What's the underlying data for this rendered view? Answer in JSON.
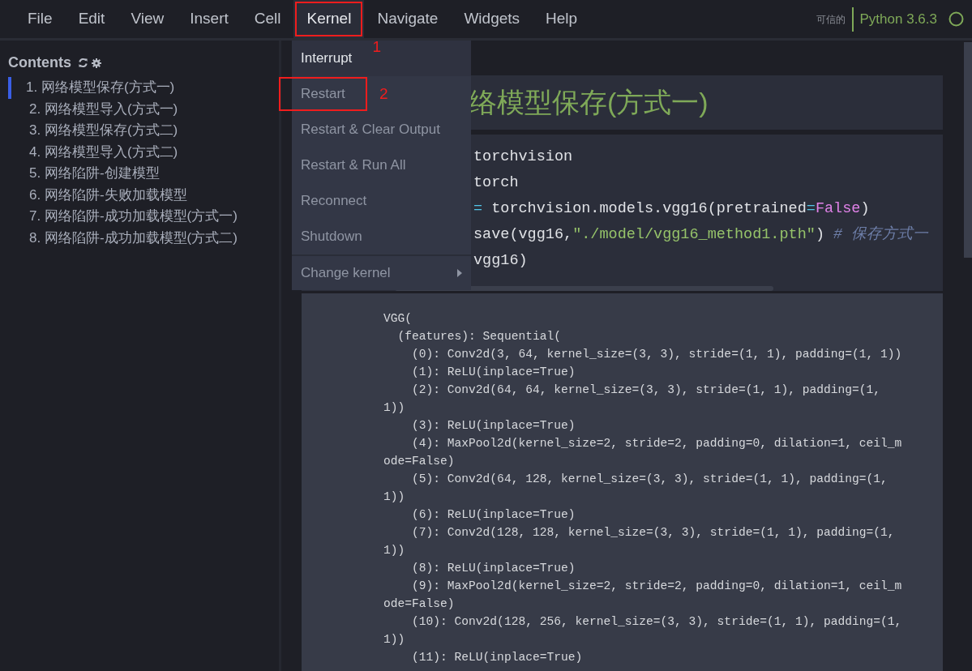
{
  "menubar": {
    "items": [
      {
        "label": "File",
        "selected": false
      },
      {
        "label": "Edit",
        "selected": false
      },
      {
        "label": "View",
        "selected": false
      },
      {
        "label": "Insert",
        "selected": false
      },
      {
        "label": "Cell",
        "selected": false
      },
      {
        "label": "Kernel",
        "selected": true,
        "annotation": "1"
      },
      {
        "label": "Navigate",
        "selected": false
      },
      {
        "label": "Widgets",
        "selected": false
      },
      {
        "label": "Help",
        "selected": false
      }
    ]
  },
  "kernel_status": {
    "trust": "可信的",
    "name": "Python 3.6.3",
    "busy": false
  },
  "kernel_menu": {
    "items": [
      {
        "label": "Interrupt",
        "kind": "item",
        "highlighted": true
      },
      {
        "label": "Restart",
        "kind": "item",
        "highlighted": false,
        "annotation": "2"
      },
      {
        "label": "Restart & Clear Output",
        "kind": "item",
        "highlighted": false
      },
      {
        "label": "Restart & Run All",
        "kind": "item",
        "highlighted": false
      },
      {
        "label": "Reconnect",
        "kind": "item",
        "highlighted": false
      },
      {
        "label": "Shutdown",
        "kind": "item",
        "highlighted": false
      },
      {
        "label": "Change kernel",
        "kind": "submenu",
        "highlighted": false
      }
    ]
  },
  "toc": {
    "title": "Contents",
    "items": [
      {
        "label": "1. 网络模型保存(方式一)",
        "selected": true
      },
      {
        "label": "2. 网络模型导入(方式一)",
        "selected": false
      },
      {
        "label": "3. 网络模型保存(方式二)",
        "selected": false
      },
      {
        "label": "4. 网络模型导入(方式二)",
        "selected": false
      },
      {
        "label": "5. 网络陷阱-创建模型",
        "selected": false
      },
      {
        "label": "6. 网络陷阱-失败加载模型",
        "selected": false
      },
      {
        "label": "7. 网络陷阱-成功加载模型(方式一)",
        "selected": false
      },
      {
        "label": "8. 网络陷阱-成功加载模型(方式二)",
        "selected": false
      }
    ]
  },
  "heading_cell": {
    "text": "络模型保存(方式一)"
  },
  "code_cell": {
    "lines": [
      [
        {
          "text": "torchvision",
          "kind": "plain"
        }
      ],
      [
        {
          "text": "torch",
          "kind": "plain"
        }
      ],
      [
        {
          "text": "=",
          "kind": "operator"
        },
        {
          "text": " torchvision.models.vgg16(pretrained",
          "kind": "plain"
        },
        {
          "text": "=",
          "kind": "operator"
        },
        {
          "text": "False",
          "kind": "keyword"
        },
        {
          "text": ")",
          "kind": "plain"
        }
      ],
      [
        {
          "text": "save(vgg16,",
          "kind": "plain"
        },
        {
          "text": "\"./model/vgg16_method1.pth\"",
          "kind": "string"
        },
        {
          "text": ") ",
          "kind": "plain"
        },
        {
          "text": "# 保存方式一",
          "kind": "comment"
        }
      ],
      [
        {
          "text": "vgg16)",
          "kind": "plain"
        }
      ]
    ]
  },
  "output_cell": {
    "lines": [
      "VGG(",
      "  (features): Sequential(",
      "    (0): Conv2d(3, 64, kernel_size=(3, 3), stride=(1, 1), padding=(1, 1))",
      "    (1): ReLU(inplace=True)",
      "    (2): Conv2d(64, 64, kernel_size=(3, 3), stride=(1, 1), padding=(1,",
      "1))",
      "    (3): ReLU(inplace=True)",
      "    (4): MaxPool2d(kernel_size=2, stride=2, padding=0, dilation=1, ceil_m",
      "ode=False)",
      "    (5): Conv2d(64, 128, kernel_size=(3, 3), stride=(1, 1), padding=(1,",
      "1))",
      "    (6): ReLU(inplace=True)",
      "    (7): Conv2d(128, 128, kernel_size=(3, 3), stride=(1, 1), padding=(1,",
      "1))",
      "    (8): ReLU(inplace=True)",
      "    (9): MaxPool2d(kernel_size=2, stride=2, padding=0, dilation=1, ceil_m",
      "ode=False)",
      "    (10): Conv2d(128, 256, kernel_size=(3, 3), stride=(1, 1), padding=(1,",
      "1))",
      "    (11): ReLU(inplace=True)"
    ]
  }
}
